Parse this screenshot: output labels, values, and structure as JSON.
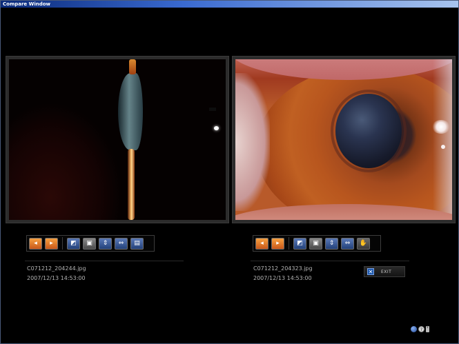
{
  "window": {
    "title": "Compare Window"
  },
  "left_panel": {
    "filename": "C071212_204244.jpg",
    "datetime": "2007/12/13 14:53:00",
    "toolbar": [
      {
        "name": "prev-image",
        "icon": "arrow-left-icon",
        "glyph": "◂"
      },
      {
        "name": "next-image",
        "icon": "arrow-right-icon",
        "glyph": "▸"
      },
      {
        "name": "rotate",
        "icon": "rotate-icon",
        "glyph": "◩"
      },
      {
        "name": "fit",
        "icon": "fit-icon",
        "glyph": "▣"
      },
      {
        "name": "flip-vertical",
        "icon": "flip-vertical-icon",
        "glyph": "⇕"
      },
      {
        "name": "flip-horizontal",
        "icon": "flip-horizontal-icon",
        "glyph": "⇔"
      },
      {
        "name": "save",
        "icon": "save-icon",
        "glyph": "▤"
      }
    ]
  },
  "right_panel": {
    "filename": "C071212_204323.jpg",
    "datetime": "2007/12/13 14:53:00",
    "toolbar": [
      {
        "name": "prev-image",
        "icon": "arrow-left-icon",
        "glyph": "◂"
      },
      {
        "name": "next-image",
        "icon": "arrow-right-icon",
        "glyph": "▸"
      },
      {
        "name": "rotate",
        "icon": "rotate-icon",
        "glyph": "◩"
      },
      {
        "name": "fit",
        "icon": "fit-icon",
        "glyph": "▣"
      },
      {
        "name": "flip-vertical",
        "icon": "flip-vertical-icon",
        "glyph": "⇕"
      },
      {
        "name": "flip-horizontal",
        "icon": "flip-horizontal-icon",
        "glyph": "⇔"
      },
      {
        "name": "open",
        "icon": "hand-icon",
        "glyph": "✋"
      }
    ]
  },
  "exit": {
    "label": "EXIT",
    "icon": "close-icon",
    "glyph": "✕"
  },
  "status": {
    "globe_icon": "globe-icon",
    "help_icon": "help-icon",
    "help_glyph": "?",
    "scroll_icon": "scroll-arrows-icon",
    "scroll_glyph": "⇕"
  },
  "colors": {
    "title_bar": "#3a6ad0",
    "accent_orange": "#f6a040",
    "accent_blue": "#22407a",
    "text": "#b4b4b4"
  }
}
